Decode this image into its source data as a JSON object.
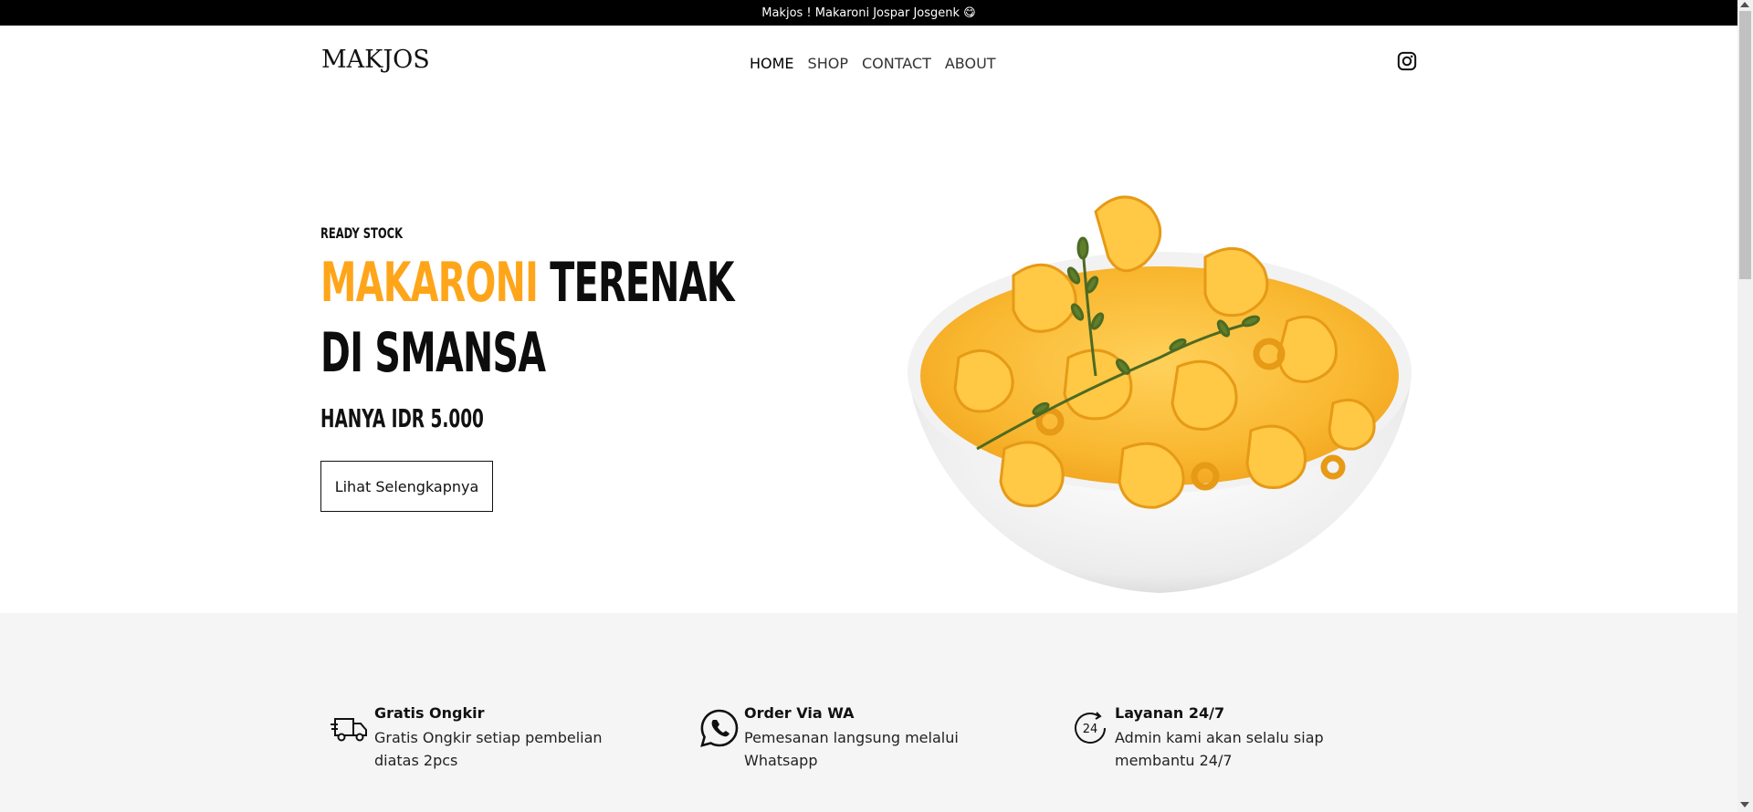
{
  "announcement": {
    "text": "Makjos ! Makaroni Jospar Josgenk 😋"
  },
  "header": {
    "logo": "MAKJOS",
    "nav": [
      {
        "label": "HOME",
        "active": true
      },
      {
        "label": "SHOP",
        "active": false
      },
      {
        "label": "CONTACT",
        "active": false
      },
      {
        "label": "ABOUT",
        "active": false
      }
    ],
    "social_icon": "instagram-icon"
  },
  "hero": {
    "eyebrow": "READY STOCK",
    "headline_accent": "MAKARONI",
    "headline_rest": " TERENAK",
    "headline_line2": "DI SMANSA",
    "price": "HANYA IDR 5.000",
    "cta_label": "Lihat Selengkapnya",
    "image_icon": "macaroni-bowl-image",
    "accent_color": "#ffa51a"
  },
  "features": [
    {
      "icon": "delivery-truck-icon",
      "title": "Gratis Ongkir",
      "description": "Gratis Ongkir setiap pembelian diatas 2pcs"
    },
    {
      "icon": "whatsapp-icon",
      "title": "Order Via WA",
      "description": "Pemesanan langsung melalui Whatsapp"
    },
    {
      "icon": "24-hours-icon",
      "title": "Layanan 24/7",
      "description": "Admin kami akan selalu siap membantu 24/7"
    }
  ]
}
